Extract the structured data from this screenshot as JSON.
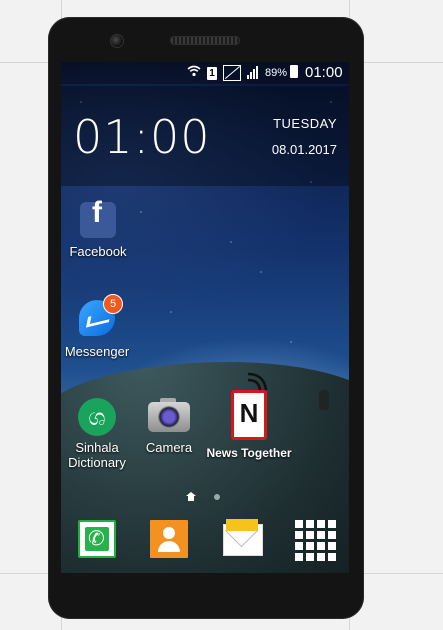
{
  "status_bar": {
    "battery_percent": "89%",
    "time": "01:00",
    "sim_slot": "1"
  },
  "clock_widget": {
    "time": "01:00",
    "day": "TUESDAY",
    "date": "08.01.2017"
  },
  "apps": [
    {
      "label": "Facebook",
      "icon": "facebook-icon"
    },
    {
      "label": "Messenger",
      "icon": "messenger-icon",
      "badge": "5"
    },
    {
      "label": "Sinhala\nDictionary",
      "icon": "sinhala-dictionary-icon"
    },
    {
      "label": "Camera",
      "icon": "camera-icon"
    },
    {
      "label": "News Together",
      "icon": "news-together-icon"
    }
  ],
  "dock": [
    {
      "name": "phone-icon"
    },
    {
      "name": "contacts-icon"
    },
    {
      "name": "email-icon"
    },
    {
      "name": "app-drawer-icon"
    }
  ],
  "colors": {
    "facebook": "#3b5998",
    "messenger": "#0a6de0",
    "badge": "#f05a1e",
    "sinhala": "#1aa35a",
    "news_red": "#d9161c",
    "phone_green": "#28b24b",
    "contacts_orange": "#f39220",
    "email_yellow": "#f7c31a"
  }
}
